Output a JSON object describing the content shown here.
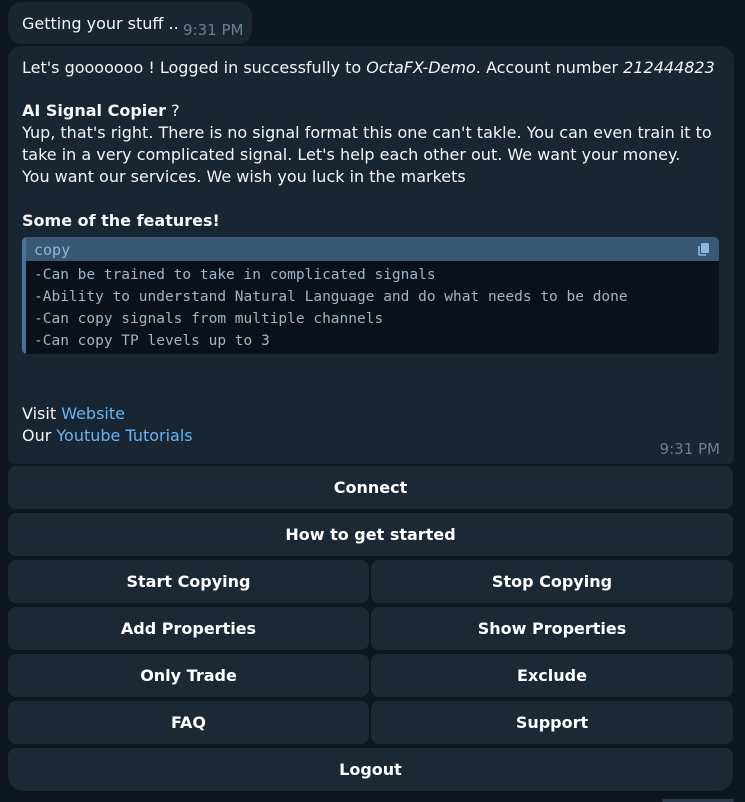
{
  "status_message": {
    "text": "Getting your stuff ..",
    "time": "9:31 PM"
  },
  "message": {
    "login_prefix": "Let's gooooooo ! Logged in successfully to ",
    "broker": "OctaFX-Demo",
    "account_label": ". Account number ",
    "account_number": "212444823",
    "heading": "AI Signal Copier",
    "heading_suffix": " ?",
    "body": "Yup, that's right. There is no signal format this one can't takle. You can even train it to take in a very complicated signal. Let's help each other out. We want your money. You want our services. We wish you luck in the markets",
    "features_heading": "Some of the features!",
    "code_block": {
      "language": "copy",
      "lines": [
        "-Can be trained to take in complicated signals",
        "-Ability to understand Natural Language and do what needs to be done",
        "-Can copy signals from multiple channels",
        "-Can copy TP levels up to 3"
      ]
    },
    "visit_prefix": "Visit ",
    "website_link": "Website",
    "tutorial_prefix": "Our ",
    "tutorial_link": "Youtube Tutorials",
    "time": "9:31 PM"
  },
  "keyboard": {
    "connect": "Connect",
    "how_to_start": "How to get started",
    "start_copying": "Start Copying",
    "stop_copying": "Stop Copying",
    "add_properties": "Add Properties",
    "show_properties": "Show Properties",
    "only_trade": "Only Trade",
    "exclude": "Exclude",
    "faq": "FAQ",
    "support": "Support",
    "logout": "Logout"
  },
  "colors": {
    "background": "#0e1621",
    "bubble": "#182533",
    "link": "#6ab3f3",
    "button": "#1b2836"
  }
}
